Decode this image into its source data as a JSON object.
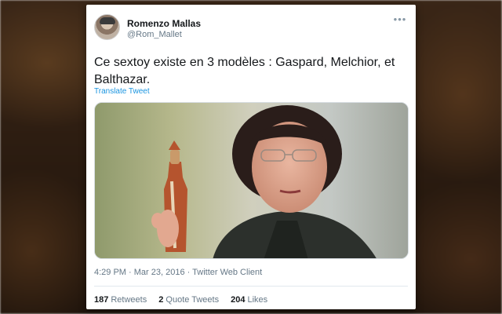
{
  "tweet": {
    "author_name": "Romenzo Mallas",
    "author_handle": "@Rom_Mallet",
    "more_icon": "more-dots-icon",
    "text": "Ce sextoy existe en 3 modèles :  Gaspard, Melchior, et Balthazar.",
    "translate_label": "Translate Tweet",
    "timestamp": "4:29 PM · Mar 23, 2016 · Twitter Web Client",
    "stats": {
      "retweets_count": "187",
      "retweets_label": "Retweets",
      "quote_count": "2",
      "quote_label": "Quote Tweets",
      "likes_count": "204",
      "likes_label": "Likes"
    },
    "colors": {
      "link": "#1b95e0",
      "secondary_text": "#657786",
      "primary_text": "#14171a"
    }
  }
}
